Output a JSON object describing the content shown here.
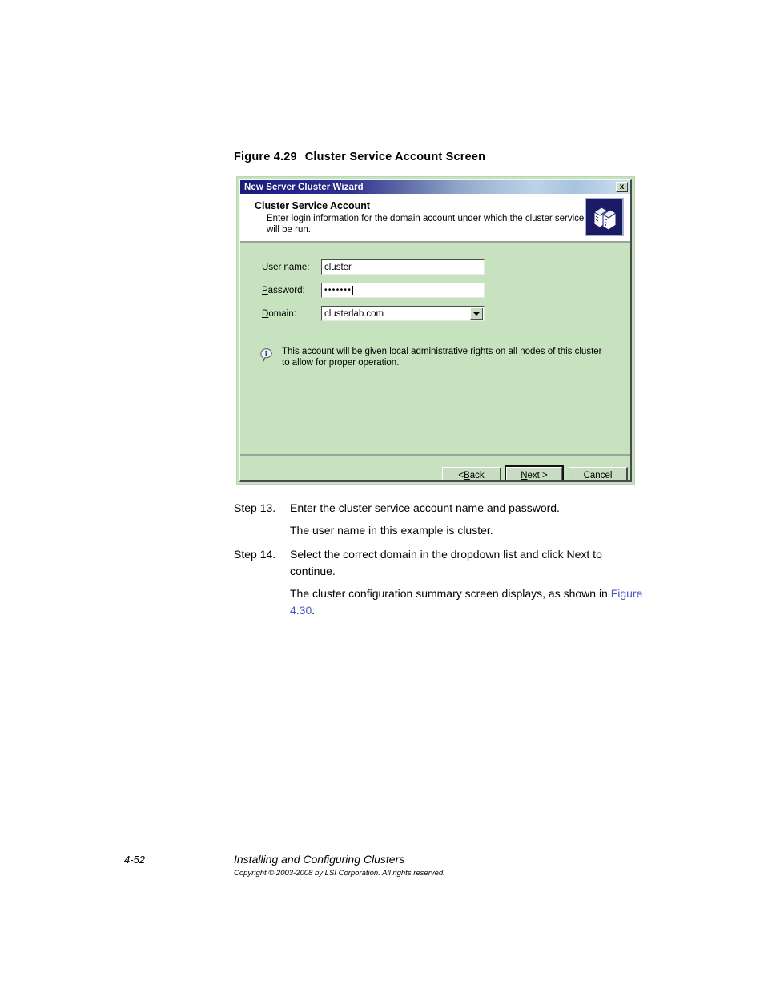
{
  "figure": {
    "number": "Figure 4.29",
    "title": "Cluster Service Account Screen"
  },
  "dialog": {
    "titlebar": {
      "title": "New Server Cluster Wizard",
      "close_label": "x",
      "close_icon": "close-icon"
    },
    "header": {
      "title": "Cluster Service Account",
      "description": "Enter login information for the domain account under which the cluster service will be run.",
      "icon": "servers-icon"
    },
    "form": {
      "username": {
        "label_accel": "U",
        "label_rest": "ser name:",
        "value": "cluster"
      },
      "password": {
        "label_accel": "P",
        "label_rest": "assword:",
        "value": "•••••••"
      },
      "domain": {
        "label_accel": "D",
        "label_rest": "omain:",
        "value": "clusterlab.com",
        "dropdown_icon": "chevron-down-icon"
      }
    },
    "note": {
      "icon": "info-icon",
      "text": "This account will be given local administrative rights on all nodes of this cluster to allow for proper operation."
    },
    "buttons": {
      "back_accel_pre": "< ",
      "back_accel": "B",
      "back_rest": "ack",
      "next_accel": "N",
      "next_rest": "ext >",
      "cancel": "Cancel"
    }
  },
  "steps": [
    {
      "label": "Step 13.",
      "text": "Enter the cluster service account name and password.",
      "note": "The user name in this example is cluster."
    },
    {
      "label": "Step 14.",
      "text": "Select the correct domain in the dropdown list and click Next to continue.",
      "note_pre": "The cluster configuration summary screen displays, as shown in ",
      "note_xref": "Figure 4.30",
      "note_post": "."
    }
  ],
  "footer": {
    "page_number": "4-52",
    "book_title": "Installing and Configuring Clusters",
    "copyright": "Copyright © 2003-2008 by LSI Corporation. All rights reserved."
  },
  "colors": {
    "dialog_body": "#c6e2bf",
    "titlebar_start": "#1c1c7a",
    "titlebar_end": "#cfe0ef",
    "xref_link": "#4a55c4",
    "icon_bg": "#1a1a66"
  }
}
